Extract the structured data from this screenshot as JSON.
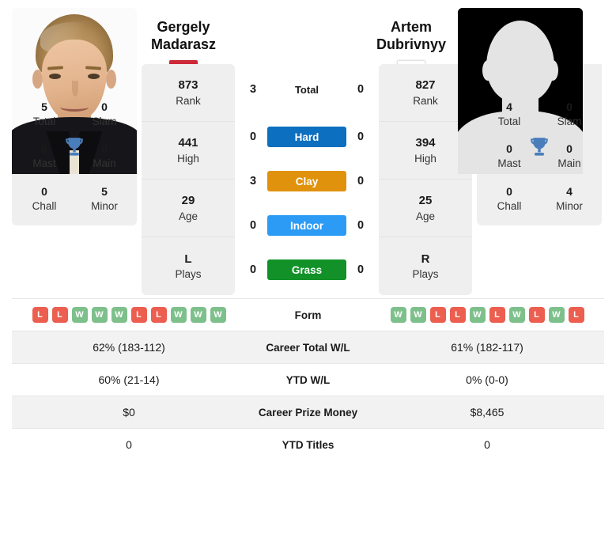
{
  "players": {
    "left": {
      "first_name": "Gergely",
      "last_name": "Madarasz",
      "full_name": "Gergely Madarasz",
      "country_flag": "hungary-flag",
      "flag_colors": [
        "#CE2939",
        "#FFFFFF",
        "#477050"
      ],
      "photo": "player-photo",
      "rank": "873",
      "rank_label": "Rank",
      "high": "441",
      "high_label": "High",
      "age": "29",
      "age_label": "Age",
      "plays": "L",
      "plays_label": "Plays",
      "titles": {
        "total": "5",
        "total_label": "Total",
        "slam": "0",
        "slam_label": "Slam",
        "mast": "0",
        "mast_label": "Mast",
        "main": "0",
        "main_label": "Main",
        "chall": "0",
        "chall_label": "Chall",
        "minor": "5",
        "minor_label": "Minor"
      },
      "form": [
        "L",
        "L",
        "W",
        "W",
        "W",
        "L",
        "L",
        "W",
        "W",
        "W"
      ],
      "career_total_wl": "62% (183-112)",
      "ytd_wl": "60% (21-14)",
      "career_prize_money": "$0",
      "ytd_titles": "0"
    },
    "right": {
      "first_name": "Artem",
      "last_name": "Dubrivnyy",
      "full_name": "Artem Dubrivnyy",
      "country_flag": "russia-flag",
      "flag_colors": [
        "#FFFFFF",
        "#2A46C0",
        "#E8554E"
      ],
      "photo": "placeholder-avatar",
      "rank": "827",
      "rank_label": "Rank",
      "high": "394",
      "high_label": "High",
      "age": "25",
      "age_label": "Age",
      "plays": "R",
      "plays_label": "Plays",
      "titles": {
        "total": "4",
        "total_label": "Total",
        "slam": "0",
        "slam_label": "Slam",
        "mast": "0",
        "mast_label": "Mast",
        "main": "0",
        "main_label": "Main",
        "chall": "0",
        "chall_label": "Chall",
        "minor": "4",
        "minor_label": "Minor"
      },
      "form": [
        "W",
        "W",
        "L",
        "L",
        "W",
        "L",
        "W",
        "L",
        "W",
        "L"
      ],
      "career_total_wl": "61% (182-117)",
      "ytd_wl": "0% (0-0)",
      "career_prize_money": "$8,465",
      "ytd_titles": "0"
    }
  },
  "h2h": {
    "total": {
      "label": "Total",
      "left": "3",
      "right": "0"
    },
    "surfaces": [
      {
        "label": "Hard",
        "left": "0",
        "right": "0",
        "color": "#0c6fbf"
      },
      {
        "label": "Clay",
        "left": "3",
        "right": "0",
        "color": "#e0920d"
      },
      {
        "label": "Indoor",
        "left": "0",
        "right": "0",
        "color": "#2c9bf5"
      },
      {
        "label": "Grass",
        "left": "0",
        "right": "0",
        "color": "#119127"
      }
    ]
  },
  "table": {
    "rows": [
      {
        "label": "Form"
      },
      {
        "label": "Career Total W/L"
      },
      {
        "label": "YTD W/L"
      },
      {
        "label": "Career Prize Money"
      },
      {
        "label": "YTD Titles"
      }
    ]
  },
  "colors": {
    "card_bg": "#efefef",
    "row_alt_bg": "#f2f2f2",
    "win_badge": "#7ec08b",
    "loss_badge": "#ec5e4f",
    "trophy": "#4a7ebb"
  }
}
